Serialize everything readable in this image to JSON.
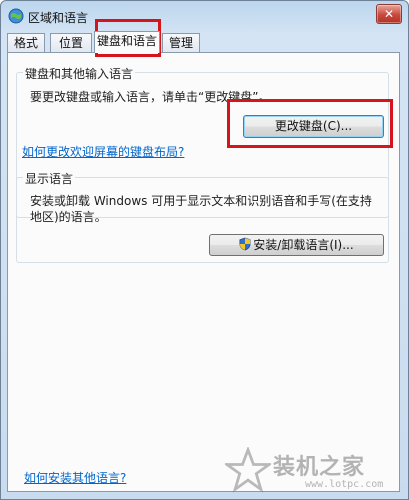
{
  "window": {
    "title": "区域和语言",
    "close_label": "✕"
  },
  "tabs": [
    {
      "label": "格式"
    },
    {
      "label": "位置"
    },
    {
      "label": "键盘和语言"
    },
    {
      "label": "管理"
    }
  ],
  "keyboard_group": {
    "legend": "键盘和其他输入语言",
    "description": "要更改键盘或输入语言，请单击“更改键盘”。",
    "button_label": "更改键盘(C)...",
    "link": "如何更改欢迎屏幕的键盘布局?"
  },
  "display_group": {
    "legend": "显示语言",
    "description": "安装或卸载 Windows 可用于显示文本和识别语音和手写(在支持地区)的语言。",
    "button_label": "安装/卸载语言(I)..."
  },
  "footer": {
    "link": "如何安装其他语言?"
  },
  "watermark": {
    "name": "装机之家",
    "url": "www.lotpc.com"
  },
  "colors": {
    "highlight": "#d6141c",
    "link": "#0066cc"
  }
}
